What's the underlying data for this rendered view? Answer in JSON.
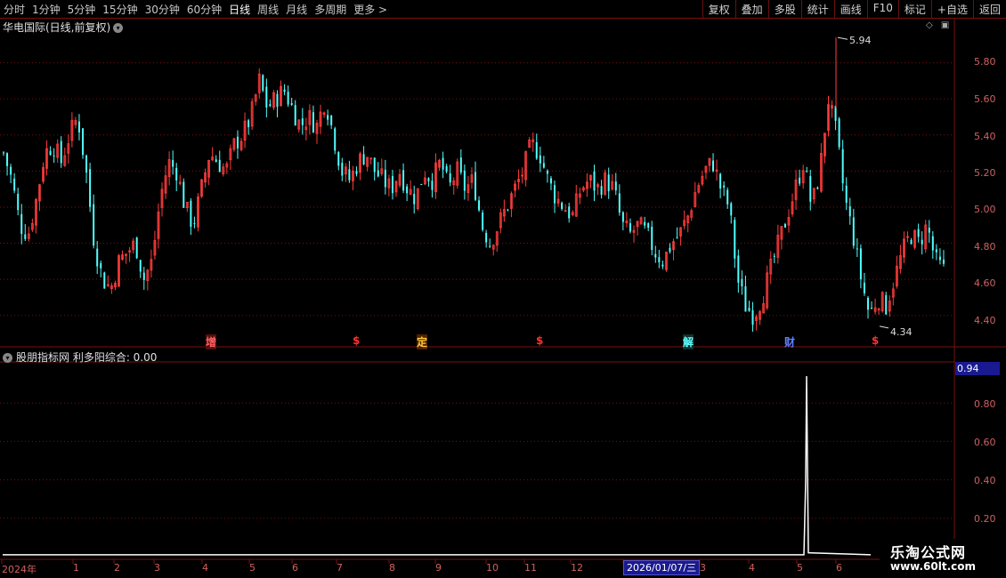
{
  "toolbar": {
    "periods": [
      "分时",
      "1分钟",
      "5分钟",
      "15分钟",
      "30分钟",
      "60分钟",
      "日线",
      "周线",
      "月线",
      "多周期",
      "更多 >"
    ],
    "active_period": "日线",
    "actions": [
      "复权",
      "叠加",
      "多股",
      "统计",
      "画线",
      "F10",
      "标记",
      "+自选",
      "返回"
    ]
  },
  "stock_title": "华电国际(日线,前复权)",
  "main_chart": {
    "y_ticks": [
      "5.80",
      "5.60",
      "5.40",
      "5.20",
      "5.00",
      "4.80",
      "4.60",
      "4.40"
    ],
    "high_label": "5.94",
    "low_label": "4.34",
    "signals": [
      "增",
      "$",
      "定",
      "$",
      "解",
      "财",
      "$"
    ]
  },
  "indicator": {
    "title": "股朋指标网 利多阳综合: 0.00",
    "current_badge": "0.94",
    "y_ticks": [
      "0.80",
      "0.60",
      "0.40",
      "0.20"
    ]
  },
  "x_axis": {
    "labels": [
      "2024年",
      "1",
      "2",
      "3",
      "4",
      "5",
      "6",
      "7",
      "8",
      "9",
      "10",
      "11",
      "12",
      "2026/01/07/三",
      "3",
      "4",
      "5",
      "6"
    ]
  },
  "watermark": {
    "line1": "乐淘公式网",
    "line2": "www.60lt.com"
  },
  "colors": {
    "up": "#ff3c3c",
    "down": "#50ffff",
    "grid": "#7a1010",
    "indicator_line": "#ffffff"
  },
  "chart_data": {
    "type": "candlestick",
    "title": "华电国际(日线,前复权)",
    "ylim": [
      4.3,
      6.0
    ],
    "close_path": [
      5.3,
      5.15,
      4.9,
      4.85,
      5.05,
      5.3,
      5.35,
      5.25,
      5.4,
      5.5,
      5.2,
      4.8,
      4.6,
      4.55,
      4.7,
      4.75,
      4.8,
      4.6,
      4.7,
      5.05,
      5.25,
      5.2,
      5.0,
      4.9,
      5.1,
      5.3,
      5.25,
      5.2,
      5.35,
      5.4,
      5.5,
      5.7,
      5.55,
      5.6,
      5.65,
      5.55,
      5.45,
      5.5,
      5.45,
      5.6,
      5.4,
      5.2,
      5.15,
      5.25,
      5.3,
      5.2,
      5.15,
      5.1,
      5.2,
      5.1,
      5.05,
      5.2,
      5.15,
      5.25,
      5.1,
      5.2,
      5.1,
      5.15,
      4.9,
      4.8,
      4.9,
      5.0,
      5.1,
      5.2,
      5.35,
      5.3,
      5.15,
      5.05,
      5.0,
      4.95,
      5.1,
      5.15,
      5.1,
      5.15,
      5.1,
      4.9,
      4.85,
      4.9,
      4.85,
      4.75,
      4.7,
      4.8,
      4.85,
      4.95,
      5.1,
      5.2,
      5.25,
      5.1,
      5.0,
      4.6,
      4.45,
      4.4,
      4.5,
      4.65,
      4.8,
      4.95,
      5.1,
      5.25,
      5.0,
      5.2,
      5.6,
      5.4,
      5.05,
      4.85,
      4.6,
      4.4,
      4.5,
      4.45,
      4.6,
      4.75,
      4.85,
      4.8,
      4.9,
      4.7,
      4.65
    ],
    "indicator_series": {
      "name": "利多阳综合",
      "spike_value": 0.94,
      "baseline": 0.0,
      "ylim": [
        0,
        1.0
      ]
    }
  }
}
